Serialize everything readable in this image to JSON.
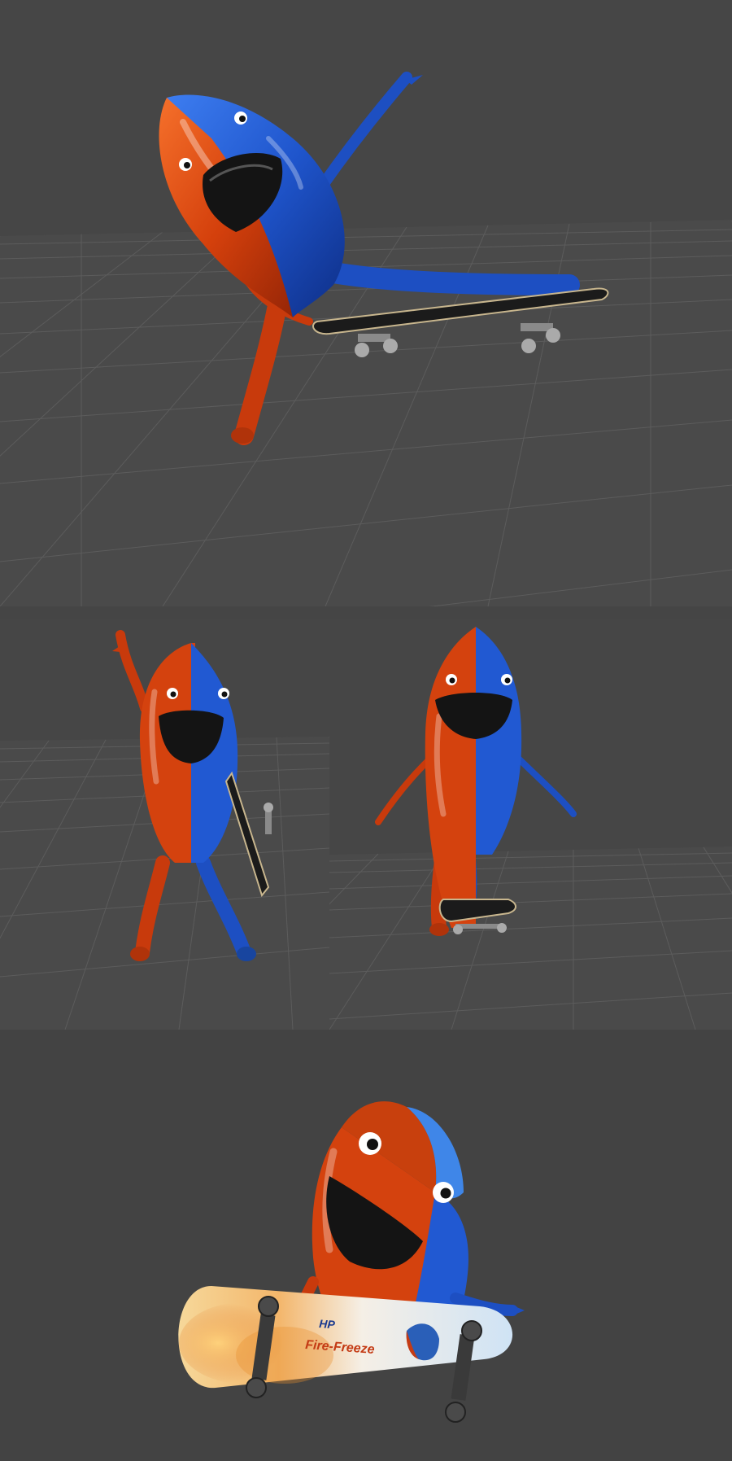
{
  "render_views": [
    {
      "view": "top",
      "pose": "skating-reach"
    },
    {
      "view": "middle-left",
      "pose": "wave-holding-board"
    },
    {
      "view": "middle-right",
      "pose": "standing-on-board"
    },
    {
      "view": "bottom",
      "pose": "showing-deck-graphic"
    }
  ],
  "deck_graphic": {
    "brand_text": "HP",
    "product_text": "Fire-Freeze"
  },
  "colors": {
    "background": "#454545",
    "grid": "#5e5e5e",
    "fire": "#d8440e",
    "freeze": "#1f5fd6",
    "deck_grip": "#1b1b1b",
    "trucks": "#9a9a9a"
  }
}
